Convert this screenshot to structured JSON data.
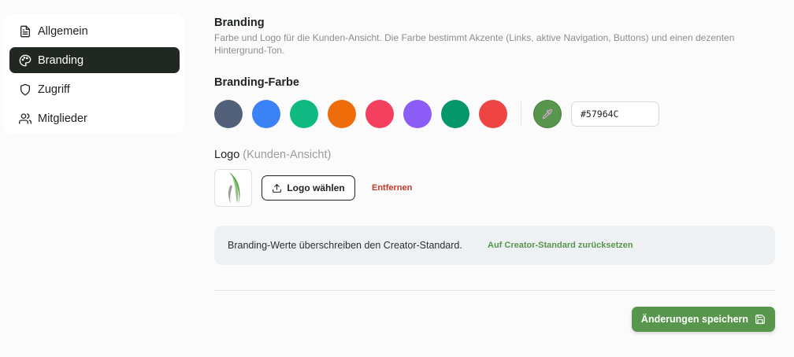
{
  "sidebar": {
    "items": [
      {
        "label": "Allgemein",
        "icon": "document-icon"
      },
      {
        "label": "Branding",
        "icon": "palette-icon",
        "active": true
      },
      {
        "label": "Zugriff",
        "icon": "shield-icon"
      },
      {
        "label": "Mitglieder",
        "icon": "users-icon"
      }
    ]
  },
  "section": {
    "title": "Branding",
    "description": "Farbe und Logo für die Kunden-Ansicht. Die Farbe bestimmt Akzente (Links, aktive Navigation, Buttons) und einen dezenten Hintergrund-Ton."
  },
  "color": {
    "label": "Branding-Farbe",
    "swatches": [
      "#52607a",
      "#3b82f6",
      "#10b981",
      "#ef6c0a",
      "#f43f5e",
      "#8b5cf6",
      "#059669",
      "#ef4444"
    ],
    "custom_color": "#57964c",
    "hex_value": "#57964C"
  },
  "logo": {
    "label": "Logo",
    "label_hint": "(Kunden-Ansicht)",
    "choose_button": "Logo wählen",
    "remove_button": "Entfernen"
  },
  "info": {
    "text": "Branding-Werte überschreiben den Creator-Standard.",
    "reset_link": "Auf Creator-Standard zurücksetzen"
  },
  "actions": {
    "save_button": "Änderungen speichern"
  },
  "colors": {
    "accent": "#57964c",
    "active_nav": "#212822",
    "danger": "#c0392b"
  }
}
